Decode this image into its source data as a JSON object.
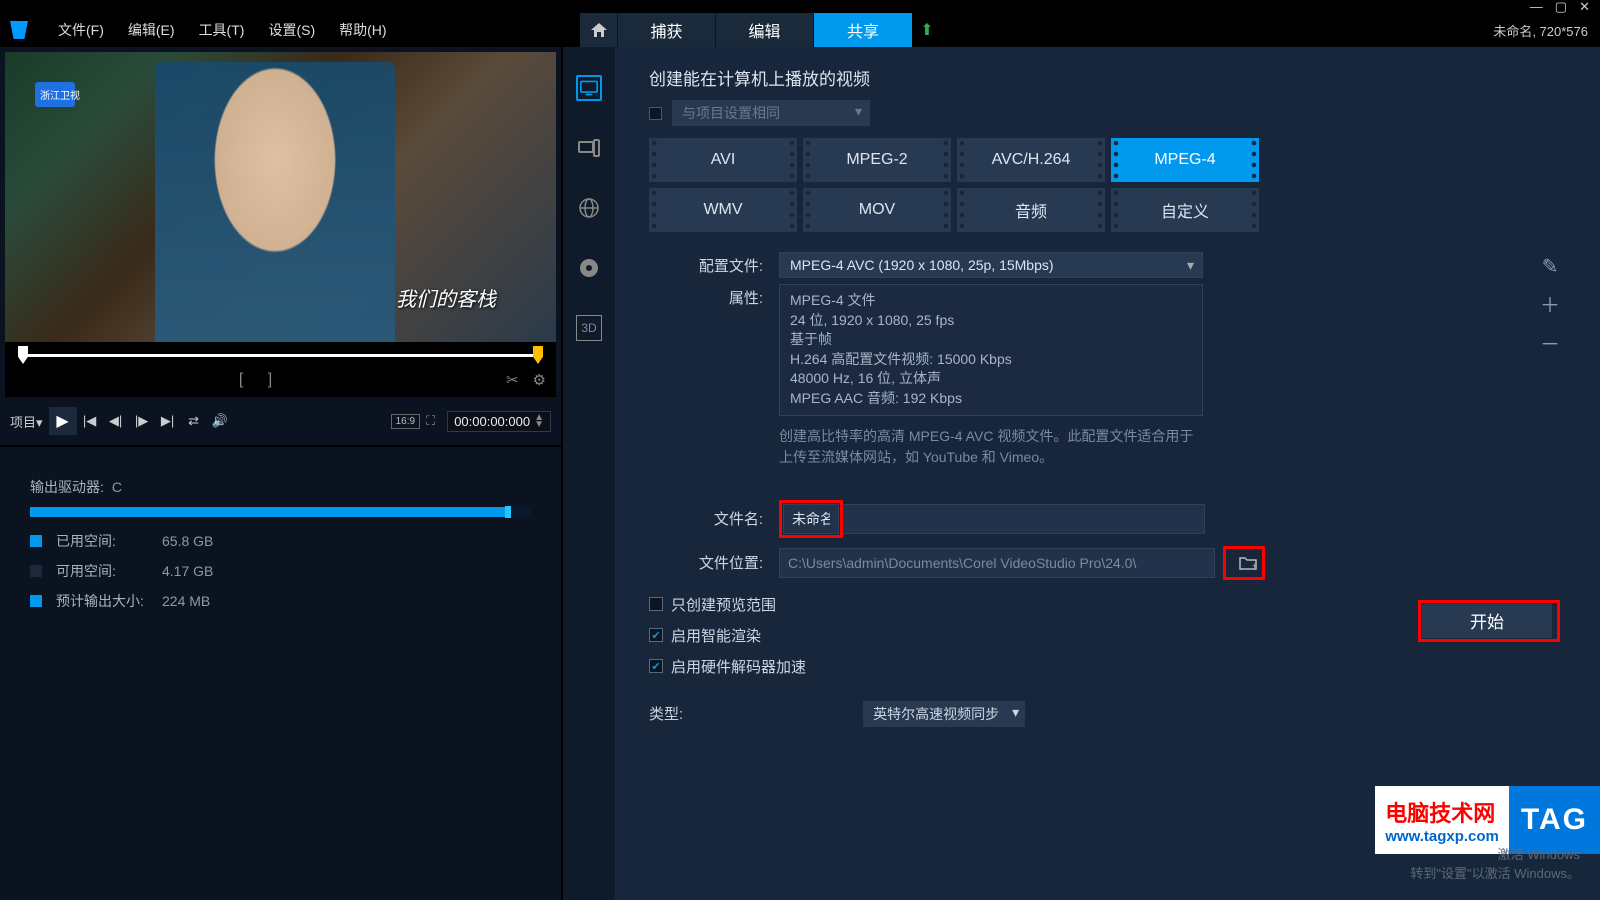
{
  "window": {
    "title_status": "未命名, 720*576"
  },
  "menu": {
    "file": "文件(F)",
    "edit": "编辑(E)",
    "tools": "工具(T)",
    "settings": "设置(S)",
    "help": "帮助(H)"
  },
  "tabs": {
    "capture": "捕获",
    "edit": "编辑",
    "share": "共享"
  },
  "preview": {
    "channel_text": "浙江卫视",
    "overlay_text": "我们的客栈",
    "label": "项目",
    "timecode": "00:00:00:000",
    "aspect": "16:9"
  },
  "storage": {
    "drive_label": "输出驱动器:",
    "drive_value": "C",
    "used_label": "已用空间:",
    "used_value": "65.8 GB",
    "free_label": "可用空间:",
    "free_value": "4.17 GB",
    "est_label": "预计输出大小:",
    "est_value": "224 MB"
  },
  "share": {
    "heading": "创建能在计算机上播放的视频",
    "same_as_project": "与项目设置相同",
    "formats": {
      "avi": "AVI",
      "mpeg2": "MPEG-2",
      "avc": "AVC/H.264",
      "mpeg4": "MPEG-4",
      "wmv": "WMV",
      "mov": "MOV",
      "audio": "音频",
      "custom": "自定义"
    },
    "profile_label": "配置文件:",
    "profile_value": "MPEG-4 AVC (1920 x 1080, 25p, 15Mbps)",
    "properties_label": "属性:",
    "properties": {
      "l1": "MPEG-4 文件",
      "l2": "24 位, 1920 x 1080, 25 fps",
      "l3": "基于帧",
      "l4": "H.264 高配置文件视频: 15000 Kbps",
      "l5": "48000 Hz, 16 位, 立体声",
      "l6": "MPEG AAC 音频: 192 Kbps"
    },
    "description": "创建高比特率的高清 MPEG-4 AVC 视频文件。此配置文件适合用于上传至流媒体网站，如 YouTube 和 Vimeo。",
    "filename_label": "文件名:",
    "filename_value": "未命名",
    "location_label": "文件位置:",
    "location_value": "C:\\Users\\admin\\Documents\\Corel VideoStudio Pro\\24.0\\",
    "only_preview": "只创建预览范围",
    "smart_render": "启用智能渲染",
    "hw_decode": "启用硬件解码器加速",
    "type_label": "类型:",
    "type_value": "英特尔高速视频同步",
    "start_btn": "开始"
  },
  "watermark": {
    "line1": "电脑技术网",
    "line2": "www.tagxp.com",
    "tag": "TAG"
  },
  "activation": {
    "line1": "激活 Windows",
    "line2": "转到\"设置\"以激活 Windows。"
  }
}
